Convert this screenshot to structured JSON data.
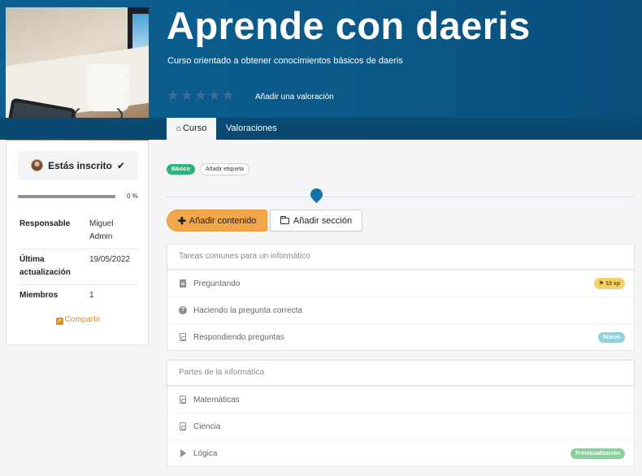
{
  "course": {
    "title": "Aprende con daeris",
    "subtitle": "Curso orientado a obtener conocimientos básicos de daeris",
    "rating_stars": 5,
    "rating_value": 0,
    "add_rating_label": "Añadir una valoración"
  },
  "tabs": [
    {
      "label": "Curso",
      "icon": "home-icon",
      "active": true
    },
    {
      "label": "Valoraciones",
      "active": false
    }
  ],
  "sidebar": {
    "enrolled_label": "Estás inscrito",
    "progress_value": 0,
    "progress_label": "0 %",
    "info": [
      {
        "key": "Responsable",
        "value": "Miguel Admin"
      },
      {
        "key": "Última actualización",
        "value": "19/05/2022"
      },
      {
        "key": "Miembros",
        "value": "1"
      }
    ],
    "share_label": "Compartir"
  },
  "tags": {
    "level": "Básico",
    "add_tag": "Añadir etiqueta"
  },
  "actions": {
    "add_content": "Añadir contenido",
    "add_section": "Añadir sección"
  },
  "sections": [
    {
      "title": "Tareas comunes para un informático",
      "items": [
        {
          "label": "Preguntando",
          "icon": "document-icon",
          "tag": "10 xp",
          "tag_type": "xp"
        },
        {
          "label": "Haciendo la pregunta correcta",
          "icon": "question-icon"
        },
        {
          "label": "Respondiendo preguntas",
          "icon": "pdf-icon",
          "tag": "Nuevo",
          "tag_type": "new"
        }
      ]
    },
    {
      "title": "Partes de la informática",
      "items": [
        {
          "label": "Matemáticas",
          "icon": "pdf-icon"
        },
        {
          "label": "Ciencia",
          "icon": "pdf-icon"
        },
        {
          "label": "Lógica",
          "icon": "play-icon",
          "tag": "Previsualización",
          "tag_type": "preview"
        }
      ]
    }
  ],
  "colors": {
    "banner": "#0c5f8f",
    "accent_orange": "#f2a74a",
    "badge_green": "#2db27a",
    "share_orange": "#e0921a"
  }
}
